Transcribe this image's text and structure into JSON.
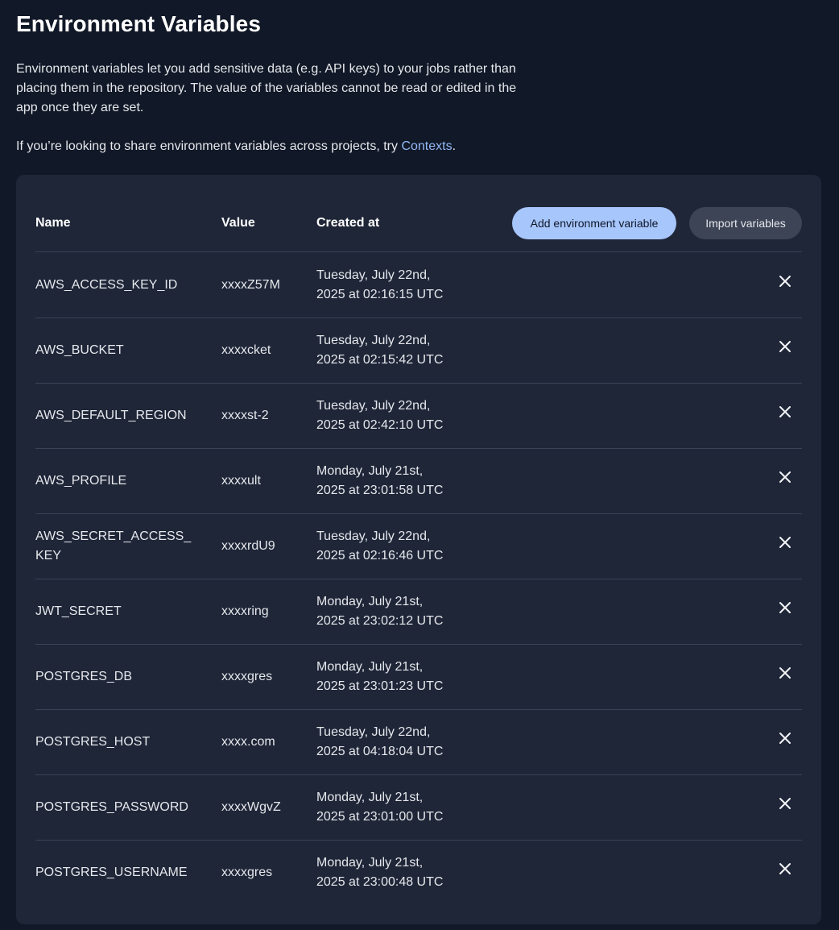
{
  "page": {
    "title": "Environment Variables",
    "intro": "Environment variables let you add sensitive data (e.g. API keys) to your jobs rather than placing them in the repository. The value of the variables cannot be read or edited in the app once they are set.",
    "hint_prefix": "If you’re looking to share environment variables across projects, try ",
    "hint_link": "Contexts",
    "hint_suffix": "."
  },
  "table": {
    "headers": {
      "name": "Name",
      "value": "Value",
      "created_at": "Created at"
    },
    "add_button": "Add environment variable",
    "import_button": "Import variables",
    "rows": [
      {
        "name": "AWS_ACCESS_KEY_ID",
        "value": "xxxxZ57M",
        "created_line1": "Tuesday, July 22nd,",
        "created_line2": "2025 at 02:16:15 UTC"
      },
      {
        "name": "AWS_BUCKET",
        "value": "xxxxcket",
        "created_line1": "Tuesday, July 22nd,",
        "created_line2": "2025 at 02:15:42 UTC"
      },
      {
        "name": "AWS_DEFAULT_REGION",
        "value": "xxxxst-2",
        "created_line1": "Tuesday, July 22nd,",
        "created_line2": "2025 at 02:42:10 UTC"
      },
      {
        "name": "AWS_PROFILE",
        "value": "xxxxult",
        "created_line1": "Monday, July 21st,",
        "created_line2": "2025 at 23:01:58 UTC"
      },
      {
        "name": "AWS_SECRET_ACCESS_KEY",
        "value": "xxxxrdU9",
        "created_line1": "Tuesday, July 22nd,",
        "created_line2": "2025 at 02:16:46 UTC"
      },
      {
        "name": "JWT_SECRET",
        "value": "xxxxring",
        "created_line1": "Monday, July 21st,",
        "created_line2": "2025 at 23:02:12 UTC"
      },
      {
        "name": "POSTGRES_DB",
        "value": "xxxxgres",
        "created_line1": "Monday, July 21st,",
        "created_line2": "2025 at 23:01:23 UTC"
      },
      {
        "name": "POSTGRES_HOST",
        "value": "xxxx.com",
        "created_line1": "Tuesday, July 22nd,",
        "created_line2": "2025 at 04:18:04 UTC"
      },
      {
        "name": "POSTGRES_PASSWORD",
        "value": "xxxxWgvZ",
        "created_line1": "Monday, July 21st,",
        "created_line2": "2025 at 23:01:00 UTC"
      },
      {
        "name": "POSTGRES_USERNAME",
        "value": "xxxxgres",
        "created_line1": "Monday, July 21st,",
        "created_line2": "2025 at 23:00:48 UTC"
      }
    ],
    "delete_icon": "close-icon"
  },
  "colors": {
    "background": "#111827",
    "panel": "#1f2638",
    "accent_button": "#a7c6fb",
    "secondary_button": "#3c4456",
    "link": "#93b8f5"
  }
}
